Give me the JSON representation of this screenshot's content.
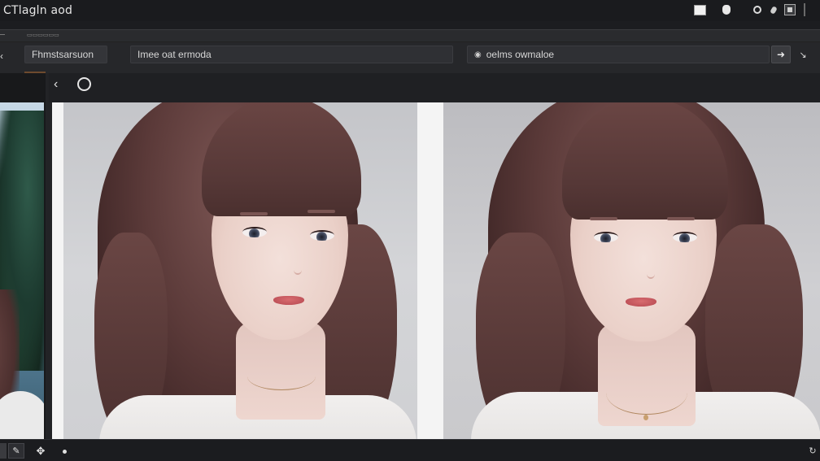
{
  "window": {
    "title": "CTlagln aod"
  },
  "strip": {
    "label": "▭▭▭▭▭▭"
  },
  "toolbar": {
    "field1": "Fhmstsarsuon",
    "field2": "Imee oat ermoda",
    "field3_prefix": "◉",
    "field3": "oelms owmaloe",
    "btn_right_glyph": "➜",
    "btn_plain_glyph": "↘"
  },
  "viewer": {
    "back_glyph": "‹"
  },
  "bottombar": {
    "pencil_glyph": "✎",
    "move_glyph": "✥",
    "rotate_glyph": "↻"
  },
  "colors": {
    "background": "#1c1d20",
    "toolbar": "#26272a",
    "accent": "#6e4a2e"
  },
  "icons": {
    "titlebar": [
      "white-square-icon",
      "shield-icon",
      "ring-icon",
      "dot-icon",
      "box-icon"
    ],
    "viewer": [
      "back-icon",
      "circle-icon"
    ],
    "bottom": [
      "pencil-icon",
      "move-icon",
      "dot-icon",
      "rotate-icon"
    ]
  }
}
